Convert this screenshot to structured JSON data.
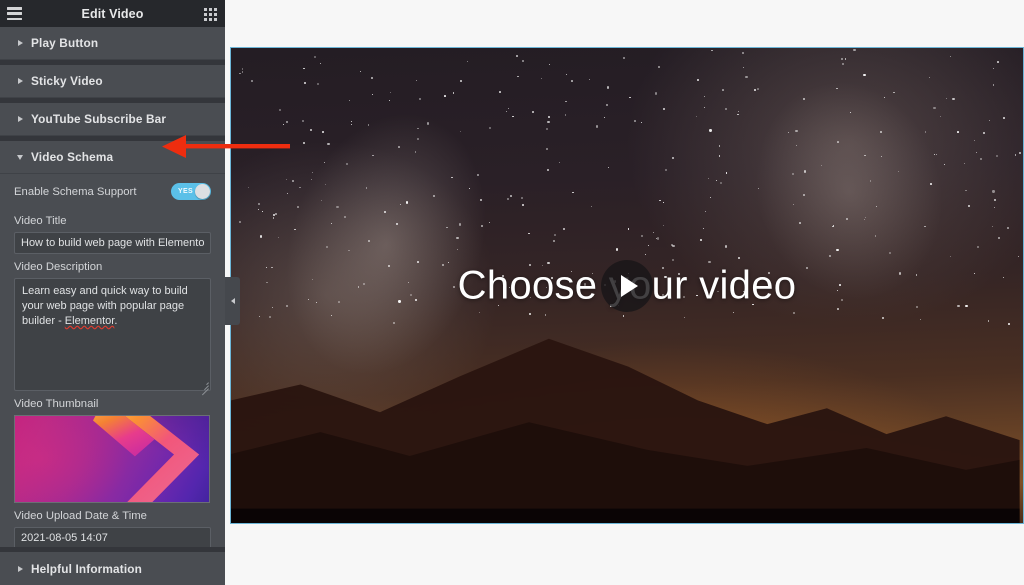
{
  "panel": {
    "title": "Edit Video",
    "menu_icon": "hamburger-icon",
    "apps_icon": "grid-icon",
    "sections": [
      {
        "label": "Play Button",
        "expanded": false
      },
      {
        "label": "Sticky Video",
        "expanded": false
      },
      {
        "label": "YouTube Subscribe Bar",
        "expanded": false
      },
      {
        "label": "Video Schema",
        "expanded": true
      }
    ],
    "bottom_section": {
      "label": "Helpful Information",
      "expanded": false
    },
    "video_schema": {
      "enable_label": "Enable Schema Support",
      "enable_toggle_value": "YES",
      "enable_toggle_on": true,
      "title_label": "Video Title",
      "title_value": "How to build web page with Elementor",
      "title_placeholder": "",
      "description_label": "Video Description",
      "description_value": "Learn easy and quick way to build your web page with popular page builder - Elementor.",
      "description_part1": "Learn easy and quick way to build your web page with popular page builder - ",
      "description_misspelled": "Elementor",
      "description_part2": ".",
      "thumbnail_label": "Video Thumbnail",
      "upload_date_label": "Video Upload Date & Time",
      "upload_date_value": "2021-08-05 14:07"
    }
  },
  "collapse_handle": {
    "icon": "chevron-left-icon"
  },
  "preview": {
    "overlay_text": "Choose your video",
    "play_icon": "play-icon"
  },
  "annotation": {
    "type": "arrow-left",
    "color": "#ee2d0f"
  },
  "colors": {
    "panel_bg": "#34363b",
    "section_bg": "#4a4d52",
    "titlebar_bg": "#26282c",
    "toggle_on": "#5bc0e8",
    "input_bg": "#3f4246",
    "accent_border": "#6cb6d8",
    "arrow_red": "#ee2d0f",
    "text_light": "#e3e4e6"
  }
}
